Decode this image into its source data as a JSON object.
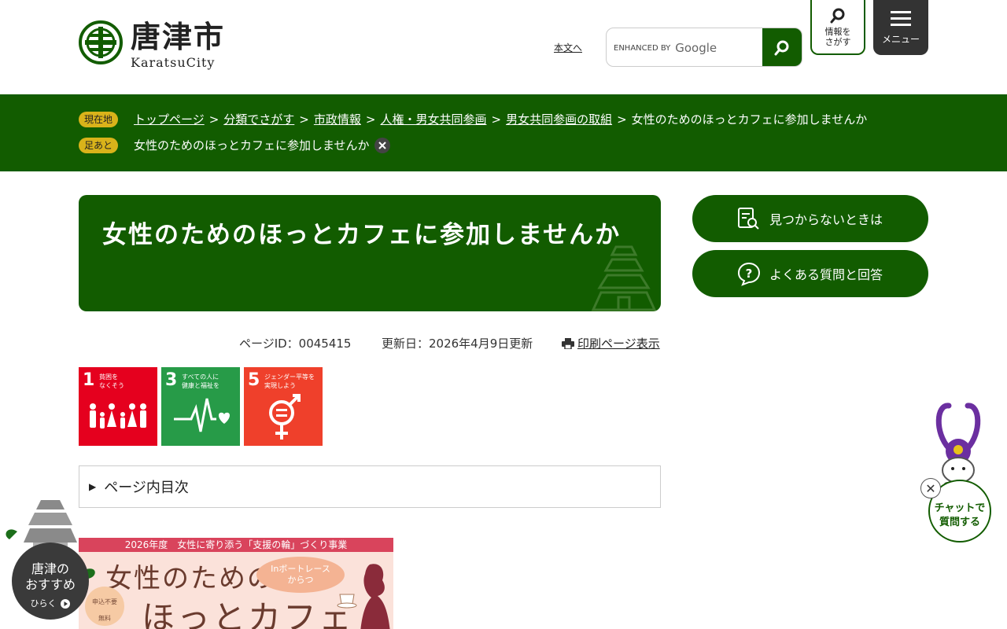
{
  "header": {
    "logo_title": "唐津市",
    "logo_sub": "KaratsuCity",
    "skip_link": "本文へ",
    "search_placeholder_prefix": "ENHANCED BY",
    "search_placeholder_brand": "Google",
    "find_button": "情報を\nさがす",
    "menu_button": "メニュー"
  },
  "breadcrumb": {
    "current_tag": "現在地",
    "items": [
      "トップページ",
      "分類でさがす",
      "市政情報",
      "人権・男女共同参画",
      "男女共同参画の取組"
    ],
    "current": "女性のためのほっとカフェに参加しませんか",
    "history_tag": "足あと",
    "history_item": "女性のためのほっとカフェに参加しませんか"
  },
  "page": {
    "title": "女性のためのほっとカフェに参加しませんか",
    "page_id": "ページID：0045415",
    "updated": "更新日：2026年4月9日更新",
    "print": "印刷ページ表示",
    "toc": "ページ内目次"
  },
  "sdgs": [
    {
      "num": "1",
      "label": "貧困を\nなくそう",
      "color": "#e5001e"
    },
    {
      "num": "3",
      "label": "すべての人に\n健康と福祉を",
      "color": "#279b48"
    },
    {
      "num": "5",
      "label": "ジェンダー平等を\n実現しよう",
      "color": "#ef402b"
    }
  ],
  "banner": {
    "top": "2026年度　女性に寄り添う「支援の輪」づくり事業",
    "line1": "女性のための",
    "line2": "ほっとカフェ",
    "bubble": "Inボートレース\nからつ",
    "badge1": "申込不要",
    "badge2": "無料"
  },
  "side": {
    "not_found": "見つからないときは",
    "faq": "よくある質問と回答"
  },
  "floaters": {
    "recommend": "唐津の\nおすすめ",
    "recommend_open": "ひらく",
    "chat": "チャットで\n質問する"
  },
  "colors": {
    "primary": "#125c00",
    "tag": "#d9b31a",
    "menu": "#333333"
  }
}
